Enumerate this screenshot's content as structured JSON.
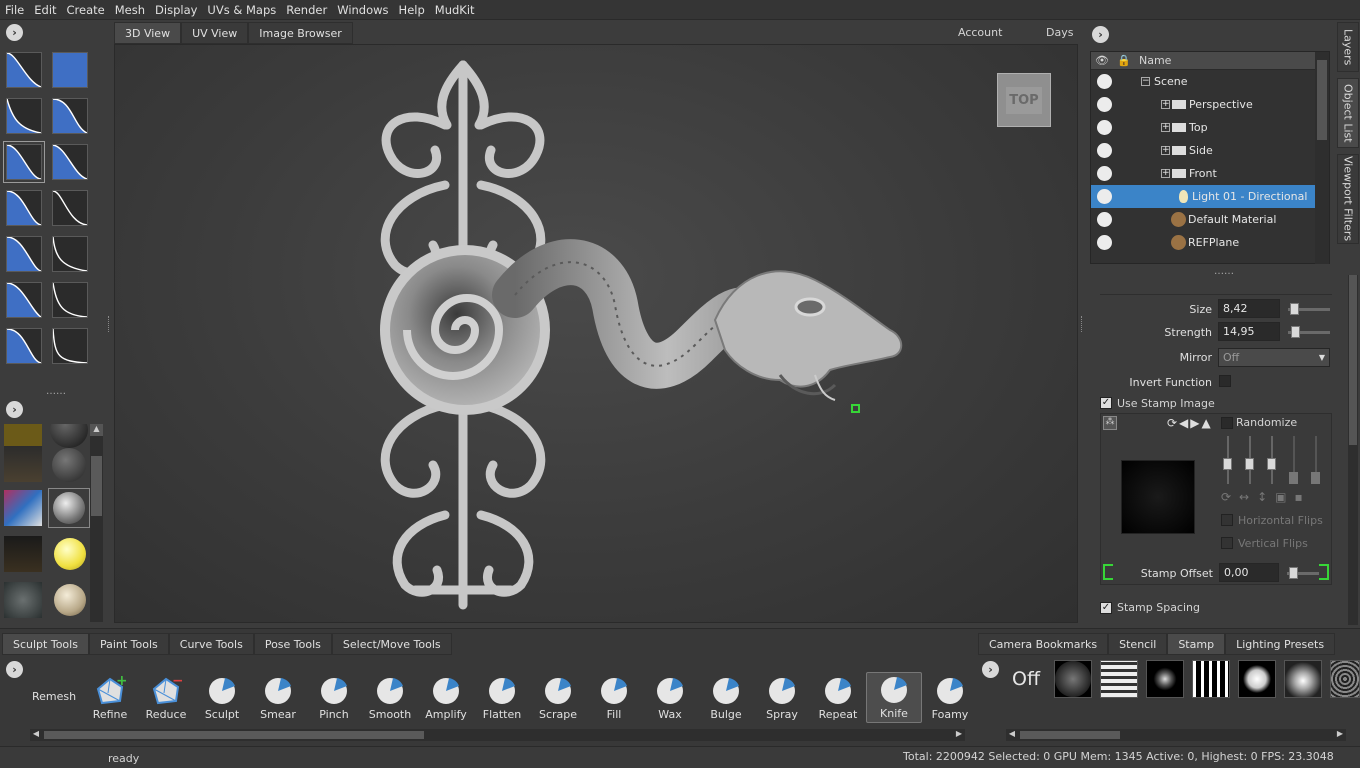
{
  "menu": [
    "File",
    "Edit",
    "Create",
    "Mesh",
    "Display",
    "UVs & Maps",
    "Render",
    "Windows",
    "Help",
    "MudKit"
  ],
  "view_tabs": [
    "3D View",
    "UV View",
    "Image Browser"
  ],
  "right_header": {
    "account": "Account",
    "days": "Days"
  },
  "viewcube_label": "TOP",
  "side_tabs": [
    "Layers",
    "Object List",
    "Viewport Filters"
  ],
  "object_list": {
    "header": "Name",
    "items": [
      {
        "label": "Scene",
        "icon": "collapse-icon"
      },
      {
        "label": "Perspective",
        "icon": "camera-icon"
      },
      {
        "label": "Top",
        "icon": "camera-icon"
      },
      {
        "label": "Side",
        "icon": "camera-icon"
      },
      {
        "label": "Front",
        "icon": "camera-icon"
      },
      {
        "label": "Light 01 - Directional",
        "icon": "light-icon"
      },
      {
        "label": "Default Material",
        "icon": "material-icon"
      },
      {
        "label": "REFPlane",
        "icon": "material-icon"
      }
    ]
  },
  "properties": {
    "size_label": "Size",
    "size_value": "8,42",
    "strength_label": "Strength",
    "strength_value": "14,95",
    "mirror_label": "Mirror",
    "mirror_value": "Off",
    "invert_label": "Invert Function",
    "use_stamp_label": "Use Stamp Image",
    "randomize_label": "Randomize",
    "hflips_label": "Horizontal Flips",
    "vflips_label": "Vertical Flips",
    "stamp_offset_label": "Stamp Offset",
    "stamp_offset_value": "0,00",
    "stamp_spacing_label": "Stamp Spacing"
  },
  "tool_tabs": [
    "Sculpt Tools",
    "Paint Tools",
    "Curve Tools",
    "Pose Tools",
    "Select/Move Tools"
  ],
  "tools": [
    "Remesh",
    "Refine",
    "Reduce",
    "Sculpt",
    "Smear",
    "Pinch",
    "Smooth",
    "Amplify",
    "Flatten",
    "Scrape",
    "Fill",
    "Wax",
    "Bulge",
    "Spray",
    "Repeat",
    "Knife",
    "Foamy"
  ],
  "stamp_tabs": [
    "Camera Bookmarks",
    "Stencil",
    "Stamp",
    "Lighting Presets"
  ],
  "stamp_off_label": "Off",
  "status": {
    "left": "ready",
    "right": "Total: 2200942  Selected: 0 GPU Mem: 1345  Active: 0, Highest: 0  FPS: 23.3048"
  },
  "colors": {
    "accent": "#3b84c8",
    "falloff_fill": "#3f6fc4",
    "selection_green": "#37d637"
  }
}
